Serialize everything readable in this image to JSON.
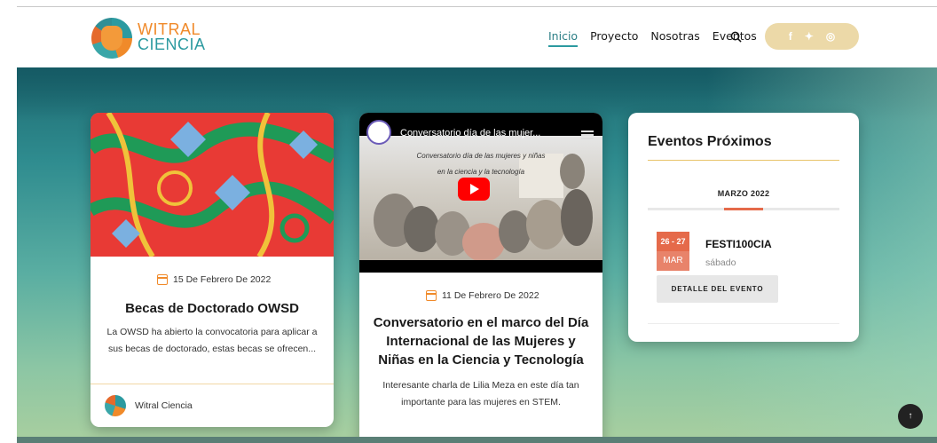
{
  "header": {
    "logo_line1": "WITRAL",
    "logo_line2": "CIENCIA",
    "nav": [
      {
        "label": "Inicio",
        "active": true
      },
      {
        "label": "Proyecto",
        "active": false
      },
      {
        "label": "Nosotras",
        "active": false
      },
      {
        "label": "Eventos",
        "active": false
      }
    ],
    "search_icon": "search-icon",
    "social": {
      "facebook": "f",
      "twitter": "✦",
      "instagram": "◎"
    }
  },
  "cards": [
    {
      "date": "15 De Febrero De 2022",
      "title": "Becas de Doctorado OWSD",
      "excerpt": "La OWSD ha abierto la convocatoria para aplicar a sus becas de doctorado, estas becas se ofrecen...",
      "author": "Witral Ciencia"
    },
    {
      "video_title": "Conversatorio día de las mujer...",
      "video_caption_1": "Conversatorio día de las mujeres y niñas",
      "video_caption_2": "en la ciencia y la tecnología",
      "date": "11 De Febrero De 2022",
      "title": "Conversatorio en el marco del Día Internacional de las Mujeres y Niñas en la Ciencia y Tecnología",
      "excerpt": "Interesante charla de Lilia Meza en este día tan importante para las mujeres en STEM."
    }
  ],
  "events": {
    "heading": "Eventos Próximos",
    "month": "MARZO 2022",
    "items": [
      {
        "range": "26 - 27",
        "month": "MAR",
        "name": "FESTI100CIA",
        "day": "sábado",
        "button": "DETALLE DEL EVENTO"
      }
    ]
  },
  "to_top": "↑",
  "colors": {
    "brand_orange": "#f08a2a",
    "brand_teal": "#2c9aa0",
    "event_red": "#e56a4a",
    "social_bg": "#ecd9a8"
  }
}
